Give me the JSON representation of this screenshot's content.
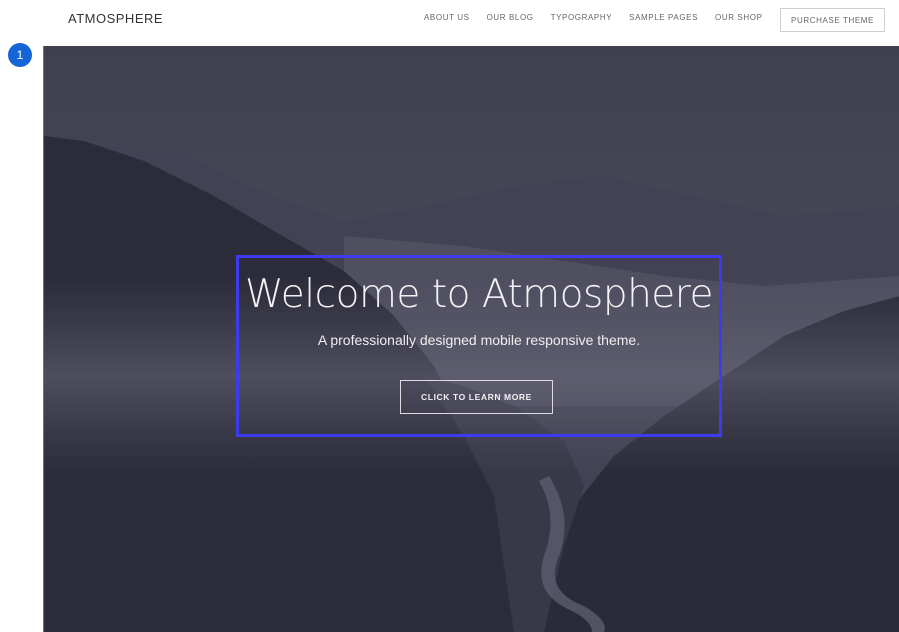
{
  "header": {
    "logo": "ATMOSPHERE",
    "nav": [
      "ABOUT US",
      "OUR BLOG",
      "TYPOGRAPHY",
      "SAMPLE PAGES",
      "OUR SHOP"
    ],
    "purchase_label": "PURCHASE THEME"
  },
  "annotation": {
    "badge_number": "1",
    "badge_color": "#1565d8",
    "highlight_color": "#3b3bf0"
  },
  "hero": {
    "title": "Welcome to Atmosphere",
    "subtitle": "A professionally designed mobile responsive theme.",
    "cta_label": "CLICK TO LEARN MORE",
    "background_image": "mountain-valley-photo"
  },
  "colors": {
    "overlay": "#3a3a4e",
    "text_light": "#f2f2f4"
  }
}
